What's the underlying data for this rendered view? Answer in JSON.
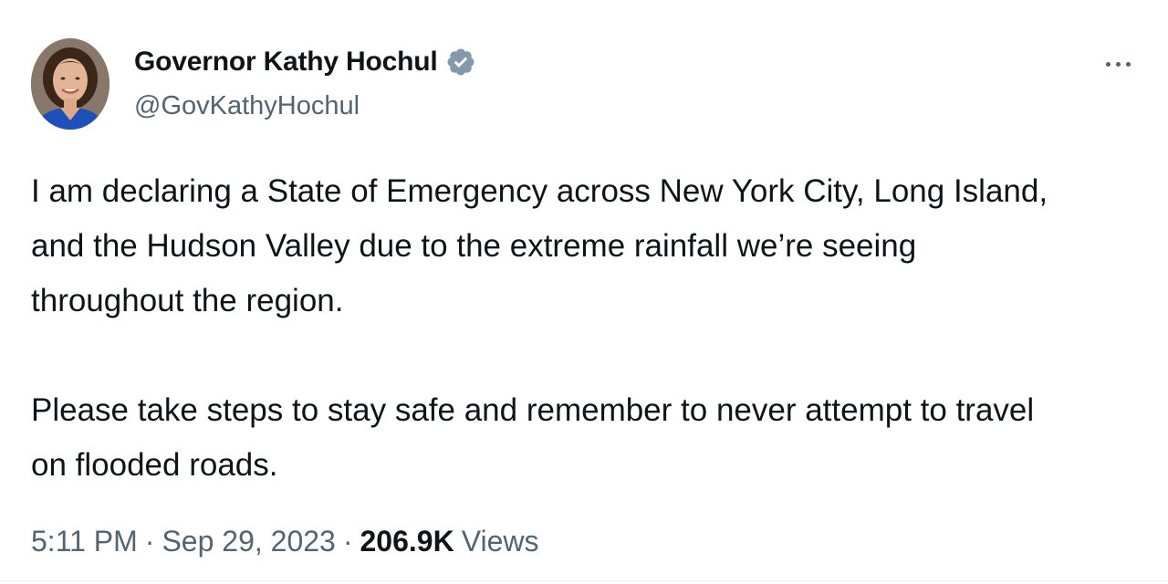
{
  "author": {
    "display_name": "Governor Kathy Hochul",
    "handle": "@GovKathyHochul",
    "avatar_icon": "profile-photo",
    "verified_icon": "verified-badge-icon",
    "verified_color": "#829aab"
  },
  "actions": {
    "more_icon": "more-options-icon"
  },
  "tweet": {
    "text": "I am declaring a State of Emergency across New York City, Long Island,\nand the Hudson Valley due to the extreme rainfall we’re seeing\nthroughout the region.\n\nPlease take steps to stay safe and remember to never attempt to travel\non flooded roads."
  },
  "meta": {
    "time": "5:11 PM",
    "separator": "·",
    "date": "Sep 29, 2023",
    "views_count": "206.9K",
    "views_label": "Views"
  },
  "colors": {
    "text_primary": "#0f1419",
    "text_secondary": "#536471",
    "background": "#ffffff"
  }
}
